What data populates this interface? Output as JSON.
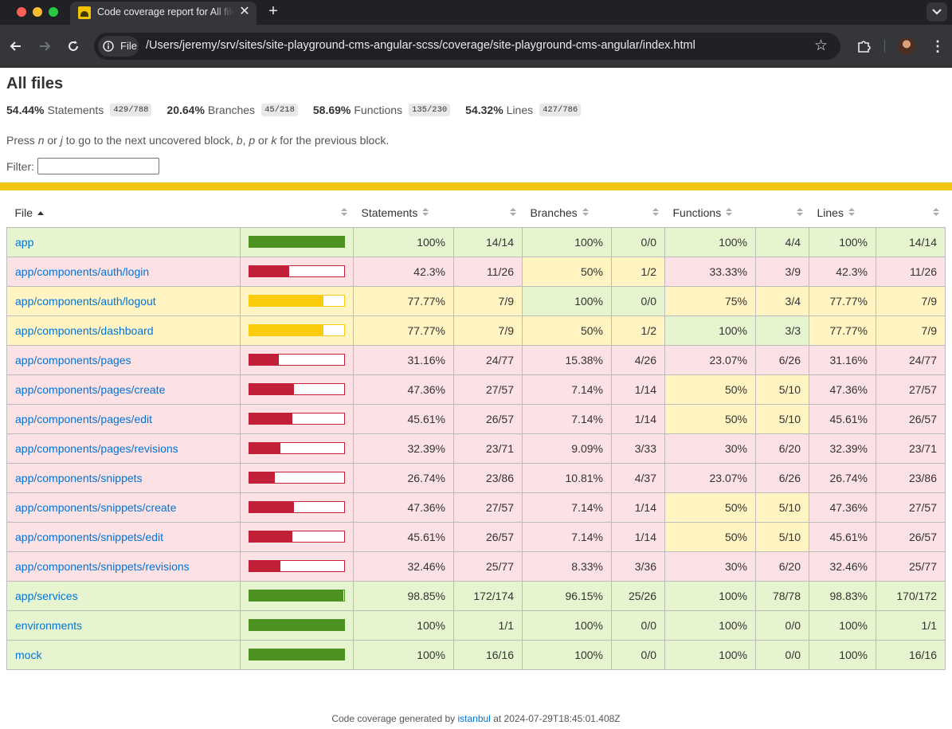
{
  "browser": {
    "tab_title": "Code coverage report for All files",
    "tab_close_icon": "close-icon",
    "new_tab_label": "+",
    "chip_label": "File",
    "url": "/Users/jeremy/srv/sites/site-playground-cms-angular-scss/coverage/site-playground-cms-angular/index.html"
  },
  "report": {
    "title": "All files",
    "summary": [
      {
        "pct": "54.44%",
        "label": "Statements",
        "fraction": "429/788"
      },
      {
        "pct": "20.64%",
        "label": "Branches",
        "fraction": "45/218"
      },
      {
        "pct": "58.69%",
        "label": "Functions",
        "fraction": "135/230"
      },
      {
        "pct": "54.32%",
        "label": "Lines",
        "fraction": "427/786"
      }
    ],
    "hint": {
      "press": "Press",
      "n": "n",
      "or1": "or",
      "j": "j",
      "mid": "to go to the next uncovered block,",
      "b": "b",
      "comma": ",",
      "p": "p",
      "or2": "or",
      "k": "k",
      "end": "for the previous block."
    },
    "filter_label": "Filter:",
    "filter_value": "",
    "columns": {
      "file": "File",
      "statements": "Statements",
      "branches": "Branches",
      "functions": "Functions",
      "lines": "Lines"
    },
    "colors": {
      "high": "#e6f5d0",
      "medium": "#fff4c2",
      "low": "#fce1e5",
      "bar_high": "#4d9221",
      "bar_medium": "#f9cd0b",
      "bar_low": "#c21f39"
    },
    "rows": [
      {
        "file": "app",
        "level": "high",
        "stmt_pct": "100%",
        "stmt_frac": "14/14",
        "br_pct": "100%",
        "br_frac": "0/0",
        "fn_pct": "100%",
        "fn_frac": "4/4",
        "ln_pct": "100%",
        "ln_frac": "14/14",
        "br_level": "high",
        "fn_level": "high",
        "bar": 100
      },
      {
        "file": "app/components/auth/login",
        "level": "low",
        "stmt_pct": "42.3%",
        "stmt_frac": "11/26",
        "br_pct": "50%",
        "br_frac": "1/2",
        "fn_pct": "33.33%",
        "fn_frac": "3/9",
        "ln_pct": "42.3%",
        "ln_frac": "11/26",
        "br_level": "medium",
        "fn_level": "low",
        "bar": 42.3
      },
      {
        "file": "app/components/auth/logout",
        "level": "medium",
        "stmt_pct": "77.77%",
        "stmt_frac": "7/9",
        "br_pct": "100%",
        "br_frac": "0/0",
        "fn_pct": "75%",
        "fn_frac": "3/4",
        "ln_pct": "77.77%",
        "ln_frac": "7/9",
        "br_level": "high",
        "fn_level": "medium",
        "bar": 77.77
      },
      {
        "file": "app/components/dashboard",
        "level": "medium",
        "stmt_pct": "77.77%",
        "stmt_frac": "7/9",
        "br_pct": "50%",
        "br_frac": "1/2",
        "fn_pct": "100%",
        "fn_frac": "3/3",
        "ln_pct": "77.77%",
        "ln_frac": "7/9",
        "br_level": "medium",
        "fn_level": "high",
        "bar": 77.77
      },
      {
        "file": "app/components/pages",
        "level": "low",
        "stmt_pct": "31.16%",
        "stmt_frac": "24/77",
        "br_pct": "15.38%",
        "br_frac": "4/26",
        "fn_pct": "23.07%",
        "fn_frac": "6/26",
        "ln_pct": "31.16%",
        "ln_frac": "24/77",
        "br_level": "low",
        "fn_level": "low",
        "bar": 31.16
      },
      {
        "file": "app/components/pages/create",
        "level": "low",
        "stmt_pct": "47.36%",
        "stmt_frac": "27/57",
        "br_pct": "7.14%",
        "br_frac": "1/14",
        "fn_pct": "50%",
        "fn_frac": "5/10",
        "ln_pct": "47.36%",
        "ln_frac": "27/57",
        "br_level": "low",
        "fn_level": "medium",
        "bar": 47.36
      },
      {
        "file": "app/components/pages/edit",
        "level": "low",
        "stmt_pct": "45.61%",
        "stmt_frac": "26/57",
        "br_pct": "7.14%",
        "br_frac": "1/14",
        "fn_pct": "50%",
        "fn_frac": "5/10",
        "ln_pct": "45.61%",
        "ln_frac": "26/57",
        "br_level": "low",
        "fn_level": "medium",
        "bar": 45.61
      },
      {
        "file": "app/components/pages/revisions",
        "level": "low",
        "stmt_pct": "32.39%",
        "stmt_frac": "23/71",
        "br_pct": "9.09%",
        "br_frac": "3/33",
        "fn_pct": "30%",
        "fn_frac": "6/20",
        "ln_pct": "32.39%",
        "ln_frac": "23/71",
        "br_level": "low",
        "fn_level": "low",
        "bar": 32.39
      },
      {
        "file": "app/components/snippets",
        "level": "low",
        "stmt_pct": "26.74%",
        "stmt_frac": "23/86",
        "br_pct": "10.81%",
        "br_frac": "4/37",
        "fn_pct": "23.07%",
        "fn_frac": "6/26",
        "ln_pct": "26.74%",
        "ln_frac": "23/86",
        "br_level": "low",
        "fn_level": "low",
        "bar": 26.74
      },
      {
        "file": "app/components/snippets/create",
        "level": "low",
        "stmt_pct": "47.36%",
        "stmt_frac": "27/57",
        "br_pct": "7.14%",
        "br_frac": "1/14",
        "fn_pct": "50%",
        "fn_frac": "5/10",
        "ln_pct": "47.36%",
        "ln_frac": "27/57",
        "br_level": "low",
        "fn_level": "medium",
        "bar": 47.36
      },
      {
        "file": "app/components/snippets/edit",
        "level": "low",
        "stmt_pct": "45.61%",
        "stmt_frac": "26/57",
        "br_pct": "7.14%",
        "br_frac": "1/14",
        "fn_pct": "50%",
        "fn_frac": "5/10",
        "ln_pct": "45.61%",
        "ln_frac": "26/57",
        "br_level": "low",
        "fn_level": "medium",
        "bar": 45.61
      },
      {
        "file": "app/components/snippets/revisions",
        "level": "low",
        "stmt_pct": "32.46%",
        "stmt_frac": "25/77",
        "br_pct": "8.33%",
        "br_frac": "3/36",
        "fn_pct": "30%",
        "fn_frac": "6/20",
        "ln_pct": "32.46%",
        "ln_frac": "25/77",
        "br_level": "low",
        "fn_level": "low",
        "bar": 32.46
      },
      {
        "file": "app/services",
        "level": "high",
        "stmt_pct": "98.85%",
        "stmt_frac": "172/174",
        "br_pct": "96.15%",
        "br_frac": "25/26",
        "fn_pct": "100%",
        "fn_frac": "78/78",
        "ln_pct": "98.83%",
        "ln_frac": "170/172",
        "br_level": "high",
        "fn_level": "high",
        "bar": 98.85
      },
      {
        "file": "environments",
        "level": "high",
        "stmt_pct": "100%",
        "stmt_frac": "1/1",
        "br_pct": "100%",
        "br_frac": "0/0",
        "fn_pct": "100%",
        "fn_frac": "0/0",
        "ln_pct": "100%",
        "ln_frac": "1/1",
        "br_level": "high",
        "fn_level": "high",
        "bar": 100
      },
      {
        "file": "mock",
        "level": "high",
        "stmt_pct": "100%",
        "stmt_frac": "16/16",
        "br_pct": "100%",
        "br_frac": "0/0",
        "fn_pct": "100%",
        "fn_frac": "0/0",
        "ln_pct": "100%",
        "ln_frac": "16/16",
        "br_level": "high",
        "fn_level": "high",
        "bar": 100
      }
    ],
    "footer": {
      "prefix": "Code coverage generated by",
      "link": "istanbul",
      "suffix": "at 2024-07-29T18:45:01.408Z"
    }
  }
}
